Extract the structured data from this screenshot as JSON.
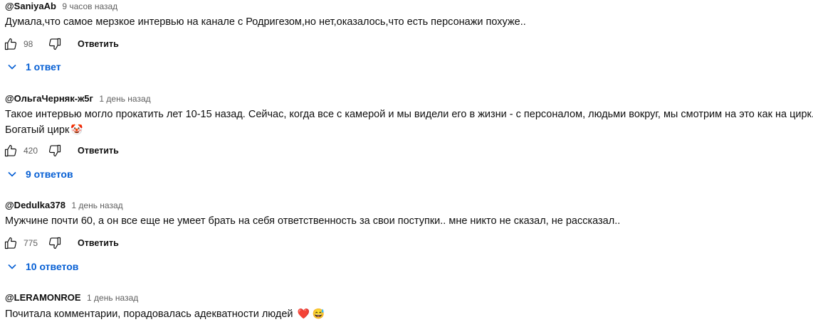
{
  "comments": [
    {
      "author": "@SaniyaAb",
      "time": "9 часов назад",
      "text": "Думала,что самое мерзкое интервью на канале с Родригезом,но нет,оказалось,что есть персонажи похуже..",
      "text2": "",
      "likes": "98",
      "reply_label": "Ответить",
      "replies_label": "1 ответ"
    },
    {
      "author": "@ОльгаЧерняк-ж5г",
      "time": "1 день назад",
      "text": "Такое интервью могло прокатить лет 10-15 назад. Сейчас, когда все с камерой и мы видели его в жизни - с персоналом, людьми вокруг, мы смотрим на это как на цирк.",
      "text2": "Богатый цирк",
      "emoji": "🤡",
      "likes": "420",
      "reply_label": "Ответить",
      "replies_label": "9 ответов"
    },
    {
      "author": "@Dedulka378",
      "time": "1 день назад",
      "text": "Мужчине почти 60, а он все еще не умеет брать на себя ответственность за свои поступки.. мне никто не сказал, не рассказал..",
      "text2": "",
      "likes": "775",
      "reply_label": "Ответить",
      "replies_label": "10 ответов"
    },
    {
      "author": "@LERAMONROE",
      "time": "1 день назад",
      "text": "Почитала комментарии, порадовалась адекватности людей",
      "emoji": "❤️ 😅"
    }
  ],
  "icons": {
    "like": "thumbs-up-icon",
    "dislike": "thumbs-down-icon",
    "expand": "chevron-down-icon"
  },
  "colors": {
    "link_blue": "#065fd4",
    "meta_gray": "#606060",
    "text": "#0f0f0f"
  }
}
